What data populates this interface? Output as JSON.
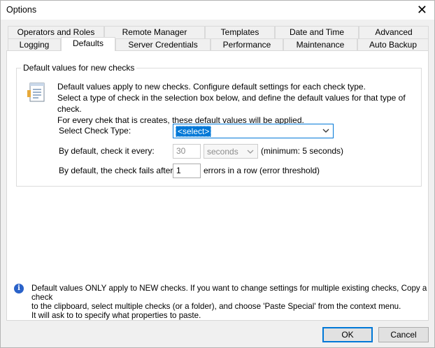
{
  "window": {
    "title": "Options",
    "close_glyph": "✕"
  },
  "tabs_row1": [
    {
      "label": "Operators and Roles"
    },
    {
      "label": "Remote Manager"
    },
    {
      "label": "Templates"
    },
    {
      "label": "Date and Time"
    },
    {
      "label": "Advanced"
    }
  ],
  "tabs_row2": [
    {
      "label": "Logging"
    },
    {
      "label": "Defaults"
    },
    {
      "label": "Server Credentials"
    },
    {
      "label": "Performance"
    },
    {
      "label": "Maintenance"
    },
    {
      "label": "Auto Backup"
    }
  ],
  "active_tab": "Defaults",
  "group": {
    "title": "Default values for new checks",
    "description": [
      "Default values apply to new checks. Configure default settings for each check type.",
      "Select a type of check in the selection box below, and define the default values for that type of check.",
      "For every chek that is creates, these default values will be applied."
    ],
    "icon": "document-list-icon"
  },
  "fields": {
    "check_type_label": "Select Check Type:",
    "check_type_value": "<select>",
    "interval_label": "By default, check it every:",
    "interval_value": "30",
    "interval_unit": "seconds",
    "interval_hint": "(minimum: 5 seconds)",
    "fail_label": "By default, the check fails after:",
    "fail_value": "1",
    "fail_hint": "errors in a row (error threshold)"
  },
  "info": {
    "icon": "info-icon",
    "lines": [
      "Default values ONLY apply to NEW checks. If you want to change settings for multiple existing checks, Copy a check",
      "to the clipboard, select multiple checks (or a folder), and choose 'Paste Special' from the context menu.",
      "It will ask to to specify what properties to paste."
    ]
  },
  "buttons": {
    "ok": "OK",
    "cancel": "Cancel"
  },
  "colors": {
    "accent": "#0078d7",
    "info": "#2a62c9"
  }
}
